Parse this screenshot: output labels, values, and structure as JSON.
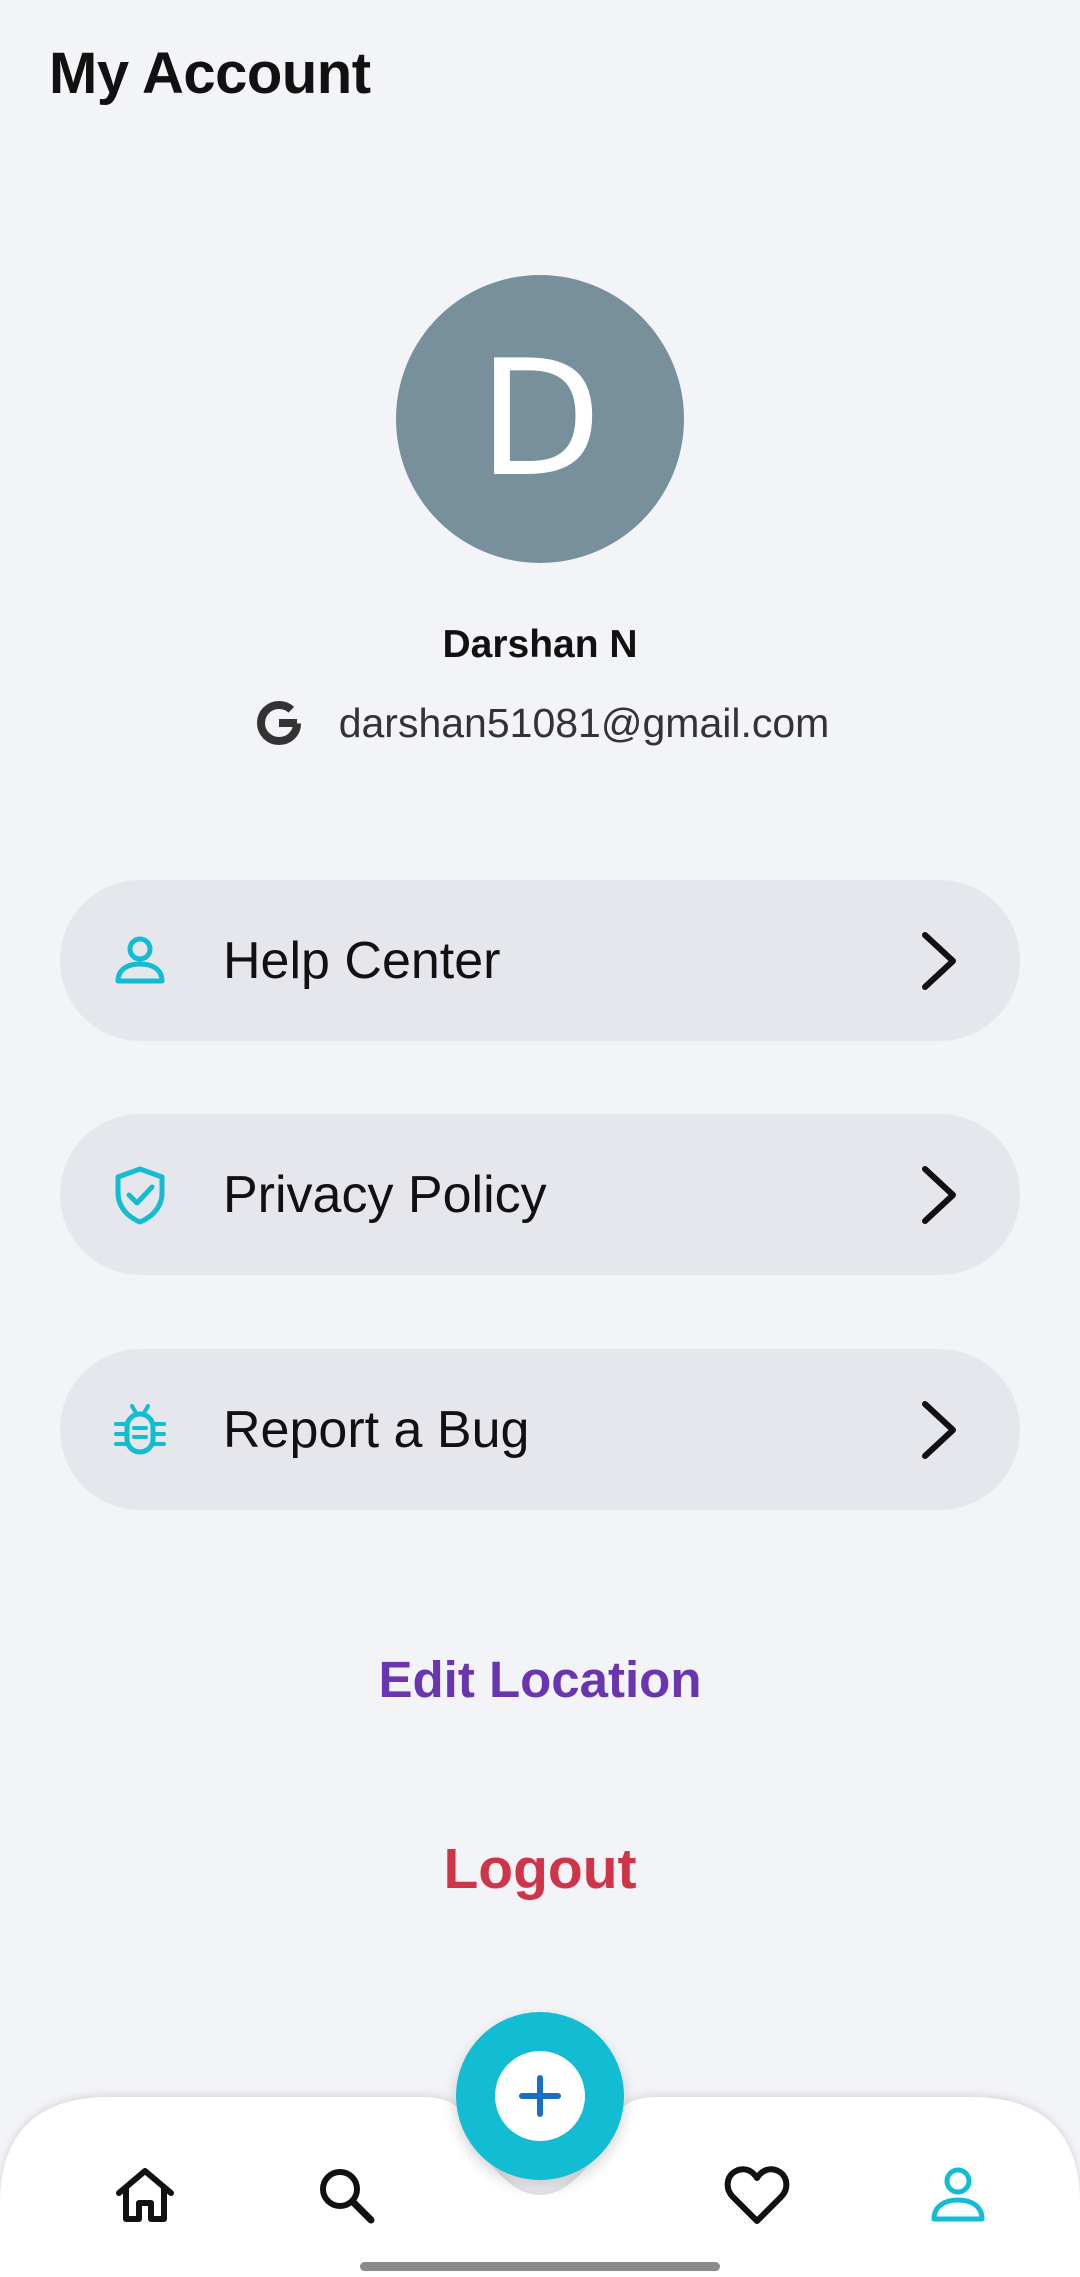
{
  "header": {
    "title": "My Account"
  },
  "profile": {
    "avatar_initial": "D",
    "avatar_color": "#78909c",
    "name": "Darshan N",
    "email": "darshan51081@gmail.com",
    "provider_icon": "google-icon"
  },
  "menu": [
    {
      "label": "Help Center",
      "icon": "person-icon"
    },
    {
      "label": "Privacy Policy",
      "icon": "shield-check-icon"
    },
    {
      "label": "Report a Bug",
      "icon": "bug-icon"
    }
  ],
  "actions": {
    "edit_location": "Edit Location",
    "logout": "Logout"
  },
  "bottom_nav": {
    "items": [
      "home-icon",
      "search-icon",
      "heart-icon",
      "profile-icon"
    ],
    "active": "profile-icon",
    "fab_icon": "plus-icon"
  },
  "colors": {
    "accent": "#12bcd3",
    "edit_location": "#6a35b0",
    "logout": "#d03448",
    "background": "#f3f4f8",
    "menu_item_bg": "#e6e7ec"
  }
}
